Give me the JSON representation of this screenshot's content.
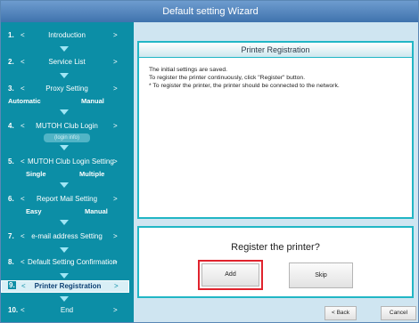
{
  "window": {
    "title": "Default setting Wizard"
  },
  "steps": [
    {
      "num": "1.",
      "lt": "<",
      "label": "Introduction",
      "gt": ">"
    },
    {
      "num": "2.",
      "lt": "<",
      "label": "Service List",
      "gt": ">"
    },
    {
      "num": "3.",
      "lt": "<",
      "label": "Proxy Setting",
      "gt": ">",
      "options": [
        "Automatic",
        "Manual"
      ]
    },
    {
      "num": "4.",
      "lt": "<",
      "label": "MUTOH Club Login",
      "gt": ">",
      "sub": "(login info)"
    },
    {
      "num": "5.",
      "lt": "<",
      "label": "MUTOH Club Login Setting",
      "gt": ">",
      "options": [
        "Single",
        "Multiple"
      ]
    },
    {
      "num": "6.",
      "lt": "<",
      "label": "Report Mail Setting",
      "gt": ">",
      "options": [
        "Easy",
        "Manual"
      ]
    },
    {
      "num": "7.",
      "lt": "<",
      "label": "e-mail address Setting",
      "gt": ">"
    },
    {
      "num": "8.",
      "lt": "<",
      "label": "Default Setting Confirmation",
      "gt": ">"
    },
    {
      "num": "9.",
      "lt": "<",
      "label": "Printer Registration",
      "gt": ">"
    },
    {
      "num": "10.",
      "lt": "<",
      "label": "End",
      "gt": ">"
    }
  ],
  "panel": {
    "title": "Printer Registration",
    "messages": [
      "The initial settings are saved.",
      "To register the printer continuously, click \"Register\" button.",
      "* To register the printer, the printer should be connected to the network."
    ]
  },
  "prompt": {
    "question": "Register the printer?",
    "add_label": "Add",
    "skip_label": "Skip"
  },
  "footer": {
    "back_label": "< Back",
    "cancel_label": "Cancel"
  },
  "colors": {
    "sidebar": "#0c8ea6",
    "panel_border": "#21b6c5",
    "highlight": "#e0232d",
    "titlebar": "#4a7fb8"
  }
}
